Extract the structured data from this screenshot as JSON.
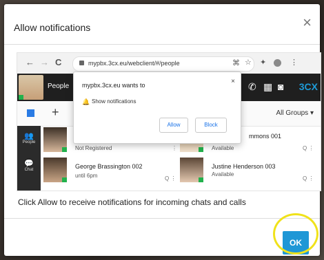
{
  "dialog": {
    "title": "Allow notifications",
    "close_glyph": "×",
    "info_text": "Click Allow to receive notifications for incoming chats and calls",
    "ok_label": "OK",
    "highlight_color": "#f0e21a",
    "ok_color": "#1e97d6"
  },
  "browser": {
    "back_glyph": "←",
    "forward_glyph": "→",
    "reload_glyph": "C",
    "url": "mypbx.3cx.eu/webclient/#/people",
    "toolbar_icons": [
      "tab-search-icon",
      "star-icon",
      "extensions-icon",
      "profile-icon",
      "menu-icon"
    ]
  },
  "app": {
    "people_label": "People",
    "brand": "3CX",
    "groups_label": "All Groups",
    "add_glyph": "+",
    "rail_items": [
      "People",
      "Chat"
    ]
  },
  "contacts": [
    {
      "name": "",
      "status": "Not Registered"
    },
    {
      "name": "mmons 001",
      "status": "Available"
    },
    {
      "name": "George Brassington 002",
      "status": "until 6pm"
    },
    {
      "name": "Justine Henderson 003",
      "status": "Available"
    }
  ],
  "permission_prompt": {
    "site": "mypbx.3cx.eu wants to",
    "description": "Show notifications",
    "allow_label": "Allow",
    "block_label": "Block",
    "close_glyph": "×"
  }
}
